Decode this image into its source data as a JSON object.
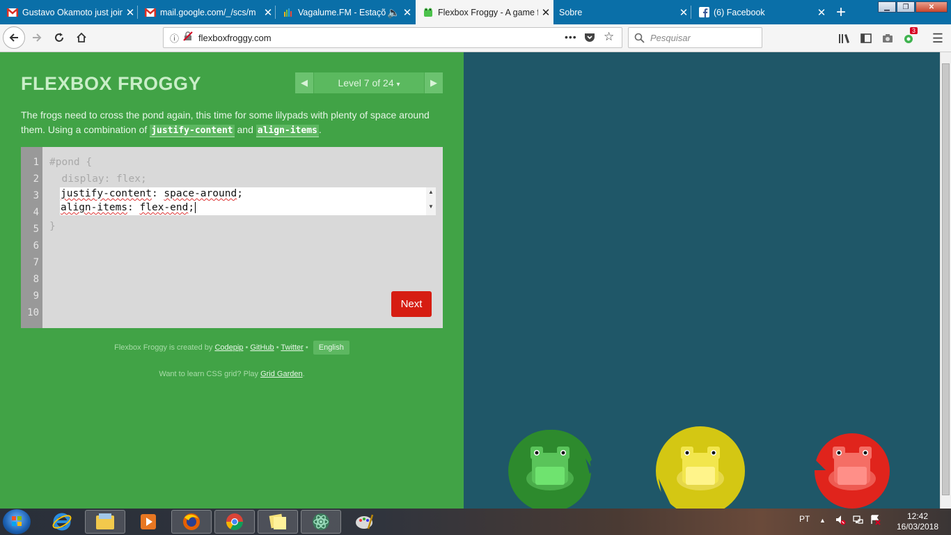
{
  "tabs": [
    {
      "label": "Gustavo Okamoto just join",
      "icon": "gmail-icon"
    },
    {
      "label": "mail.google.com/_/scs/m",
      "icon": "gmail-icon"
    },
    {
      "label": "Vagalume.FM - Estaçõ",
      "icon": "vagalume-icon"
    },
    {
      "label": "Flexbox Froggy - A game f",
      "icon": "froggy-icon"
    },
    {
      "label": "Sobre",
      "icon": ""
    },
    {
      "label": "(6) Facebook",
      "icon": "facebook-icon"
    }
  ],
  "nav": {
    "url": "flexboxfroggy.com",
    "search_placeholder": "Pesquisar",
    "notification_count": "3"
  },
  "page": {
    "title": "FLEXBOX FROGGY",
    "level_label": "Level 7 of 24",
    "level_caret": "▾",
    "desc_part1": "The frogs need to cross the pond again, this time for some lilypads with plenty of space around them. Using a combination of ",
    "desc_code1": "justify-content",
    "desc_and": " and ",
    "desc_code2": "align-items",
    "desc_end": ".",
    "line_numbers": [
      "1",
      "2",
      "3",
      "4",
      "5",
      "6",
      "7",
      "8",
      "9",
      "10"
    ],
    "code_line1": "#pond {",
    "code_line2": "  display: flex;",
    "input_line1_prop": "justify-content",
    "input_line1_sep": ": ",
    "input_line1_val": "space-around",
    "input_line1_end": ";",
    "input_line2_prop": "align-items",
    "input_line2_sep": ": ",
    "input_line2_val": "flex-end",
    "input_line2_end": ";",
    "code_close": "}",
    "next_label": "Next",
    "credits_prefix": "Flexbox Froggy is created by ",
    "credits_codepip": "Codepip",
    "credits_github": "GitHub",
    "credits_twitter": "Twitter",
    "credits_dot": " • ",
    "language": "English",
    "grid_prefix": "Want to learn CSS grid? Play ",
    "grid_link": "Grid Garden",
    "grid_end": "."
  },
  "frogs": [
    {
      "color": "green",
      "pad": "#2e8b2e",
      "body": "#6fd36f"
    },
    {
      "color": "yellow",
      "pad": "#d4c713",
      "body": "#fff36b"
    },
    {
      "color": "red",
      "pad": "#e0241c",
      "body": "#ff8077"
    }
  ],
  "taskbar": {
    "lang": "PT",
    "time": "12:42",
    "date": "16/03/2018"
  }
}
